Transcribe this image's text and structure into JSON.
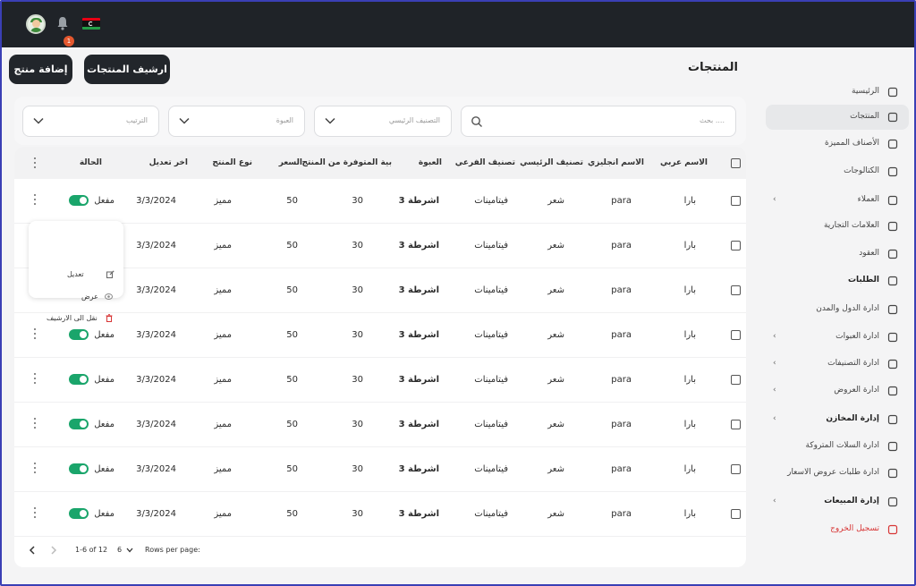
{
  "topbar": {
    "notification_count": "1"
  },
  "header": {
    "title": "المنتجات",
    "archive_button": "ارشيف المنتجات",
    "add_button": "إضافة منتج"
  },
  "sidebar": {
    "items": [
      {
        "label": "الرئيسية",
        "icon": "home-icon"
      },
      {
        "label": "المنتجات",
        "icon": "box-icon"
      },
      {
        "label": "الأصناف المميزة",
        "icon": "grid-icon"
      },
      {
        "label": "الكتالوجات",
        "icon": "catalog-icon"
      },
      {
        "label": "العملاء",
        "icon": "customers-icon"
      },
      {
        "label": "العلامات التجارية",
        "icon": "trademark-icon"
      },
      {
        "label": "العقود",
        "icon": "contract-icon"
      },
      {
        "label": "الطلبات",
        "icon": "orders-icon"
      },
      {
        "label": "ادارة الدول والمدن",
        "icon": "city-icon"
      },
      {
        "label": "ادارة العبوات",
        "icon": "packages-icon"
      },
      {
        "label": "ادارة التصنيفات",
        "icon": "categories-icon"
      },
      {
        "label": "ادارة العروض",
        "icon": "offers-icon"
      },
      {
        "label": "إدارة المخازن",
        "icon": "warehouse-icon"
      },
      {
        "label": "ادارة السلات المتروكة",
        "icon": "cart-icon"
      },
      {
        "label": "ادارة طلبات عروض الاسعار",
        "icon": "quote-icon"
      },
      {
        "label": "إدارة المبيعات",
        "icon": "sales-icon"
      },
      {
        "label": "تسجيل الخروج",
        "icon": "logout-icon"
      }
    ]
  },
  "filters": {
    "search_placeholder": "بحث ....",
    "main_category": "التصنيف الرئيسي",
    "package": "العبوة",
    "sort": "الترتيب"
  },
  "table": {
    "headers": {
      "arabic_name": "الاسم عربي",
      "english_name": "الاسم انجليزي",
      "main_category": "تصنيف الرئيسي",
      "sub_category": "تصنيف الفرعي",
      "package": "العبوة",
      "quantity": "بية المتوفرة من المنتج",
      "price": "السعر",
      "product_type": "نوع المنتج",
      "last_modified": "اخر تعديل",
      "status": "الحالة"
    },
    "rows": [
      {
        "arabic_name": "بارا",
        "english_name": "para",
        "main_category": "شعر",
        "sub_category": "فيتامينات",
        "package": "3 اشرطة",
        "quantity": "30",
        "price": "50",
        "product_type": "مميز",
        "last_modified": "3/3/2024",
        "status": "مفعل"
      },
      {
        "arabic_name": "بارا",
        "english_name": "para",
        "main_category": "شعر",
        "sub_category": "فيتامينات",
        "package": "3 اشرطة",
        "quantity": "30",
        "price": "50",
        "product_type": "مميز",
        "last_modified": "3/3/2024",
        "status": ""
      },
      {
        "arabic_name": "بارا",
        "english_name": "para",
        "main_category": "شعر",
        "sub_category": "فيتامينات",
        "package": "3 اشرطة",
        "quantity": "30",
        "price": "50",
        "product_type": "مميز",
        "last_modified": "3/3/2024",
        "status": ""
      },
      {
        "arabic_name": "بارا",
        "english_name": "para",
        "main_category": "شعر",
        "sub_category": "فيتامينات",
        "package": "3 اشرطة",
        "quantity": "30",
        "price": "50",
        "product_type": "مميز",
        "last_modified": "3/3/2024",
        "status": "مفعل"
      },
      {
        "arabic_name": "بارا",
        "english_name": "para",
        "main_category": "شعر",
        "sub_category": "فيتامينات",
        "package": "3 اشرطة",
        "quantity": "30",
        "price": "50",
        "product_type": "مميز",
        "last_modified": "3/3/2024",
        "status": "مفعل"
      },
      {
        "arabic_name": "بارا",
        "english_name": "para",
        "main_category": "شعر",
        "sub_category": "فيتامينات",
        "package": "3 اشرطة",
        "quantity": "30",
        "price": "50",
        "product_type": "مميز",
        "last_modified": "3/3/2024",
        "status": "مفعل"
      },
      {
        "arabic_name": "بارا",
        "english_name": "para",
        "main_category": "شعر",
        "sub_category": "فيتامينات",
        "package": "3 اشرطة",
        "quantity": "30",
        "price": "50",
        "product_type": "مميز",
        "last_modified": "3/3/2024",
        "status": "مفعل"
      },
      {
        "arabic_name": "بارا",
        "english_name": "para",
        "main_category": "شعر",
        "sub_category": "فيتامينات",
        "package": "3 اشرطة",
        "quantity": "30",
        "price": "50",
        "product_type": "مميز",
        "last_modified": "3/3/2024",
        "status": "مفعل"
      }
    ]
  },
  "row_menu": {
    "edit": "تعديل",
    "view": "عرض",
    "archive": "نقل الى الارشيف"
  },
  "pagination": {
    "range": "1-6 of 12",
    "per_page": "6",
    "rows_label": "Rows per page:"
  },
  "colors": {
    "accent": "#1aa56b",
    "dark": "#22262b",
    "logout": "#d73535"
  }
}
